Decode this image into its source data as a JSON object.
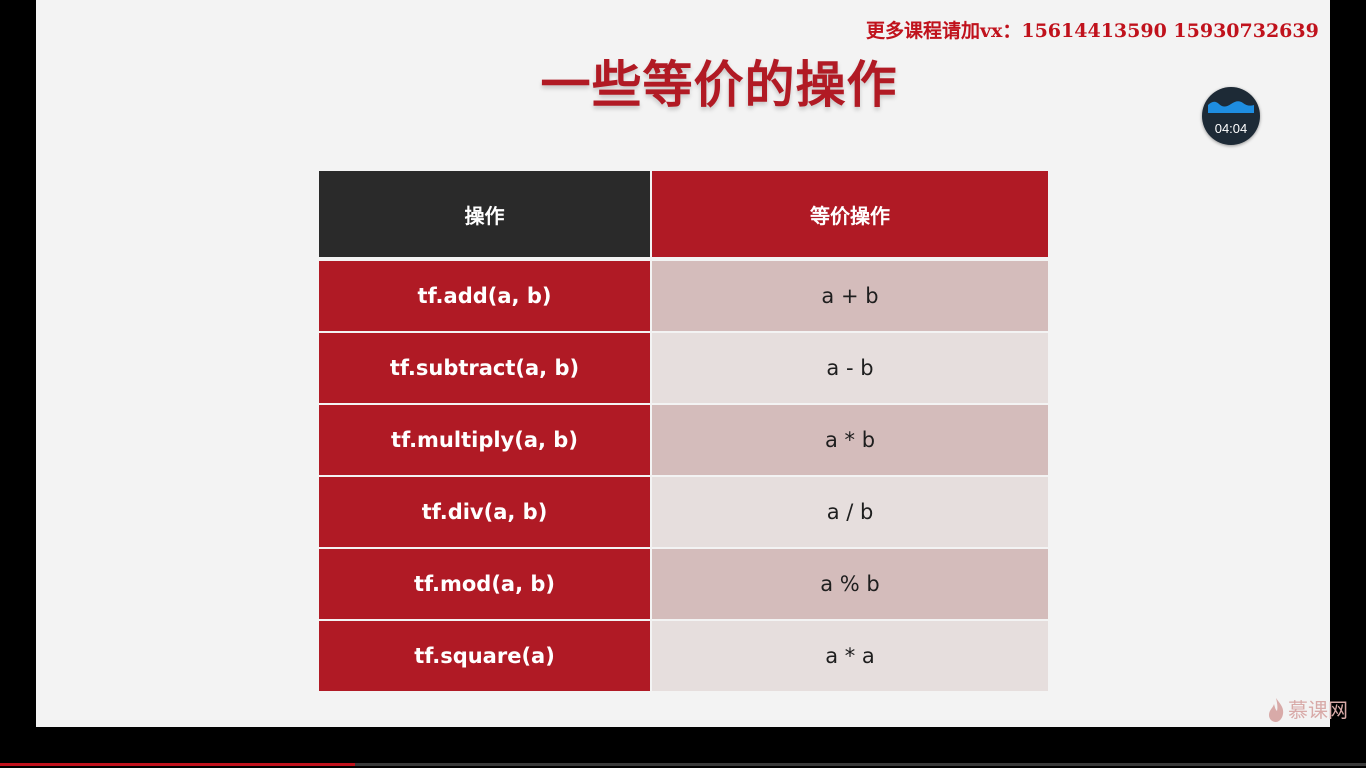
{
  "watermark": "更多课程请加vx：15614413590  15930732639",
  "slide": {
    "title": "一些等价的操作"
  },
  "table": {
    "headers": [
      "操作",
      "等价操作"
    ],
    "rows": [
      {
        "op": "tf.add(a, b)",
        "eq": "a + b"
      },
      {
        "op": "tf.subtract(a, b)",
        "eq": "a - b"
      },
      {
        "op": "tf.multiply(a, b)",
        "eq": "a * b"
      },
      {
        "op": "tf.div(a, b)",
        "eq": "a / b"
      },
      {
        "op": "tf.mod(a, b)",
        "eq": "a % b"
      },
      {
        "op": "tf.square(a)",
        "eq": "a * a"
      }
    ]
  },
  "timer": {
    "time": "04:04",
    "icon": "wave-icon"
  },
  "logo": {
    "text": "慕课网",
    "icon": "flame-icon"
  },
  "player": {
    "progress_fraction": 0.26
  },
  "colors": {
    "accent_red": "#b01a25",
    "header_dark": "#2a2a2a",
    "row_light_a": "#d4bcbb",
    "row_light_b": "#e6dedd",
    "watermark_red": "#c0121c",
    "timer_blue": "#1e8de0"
  }
}
